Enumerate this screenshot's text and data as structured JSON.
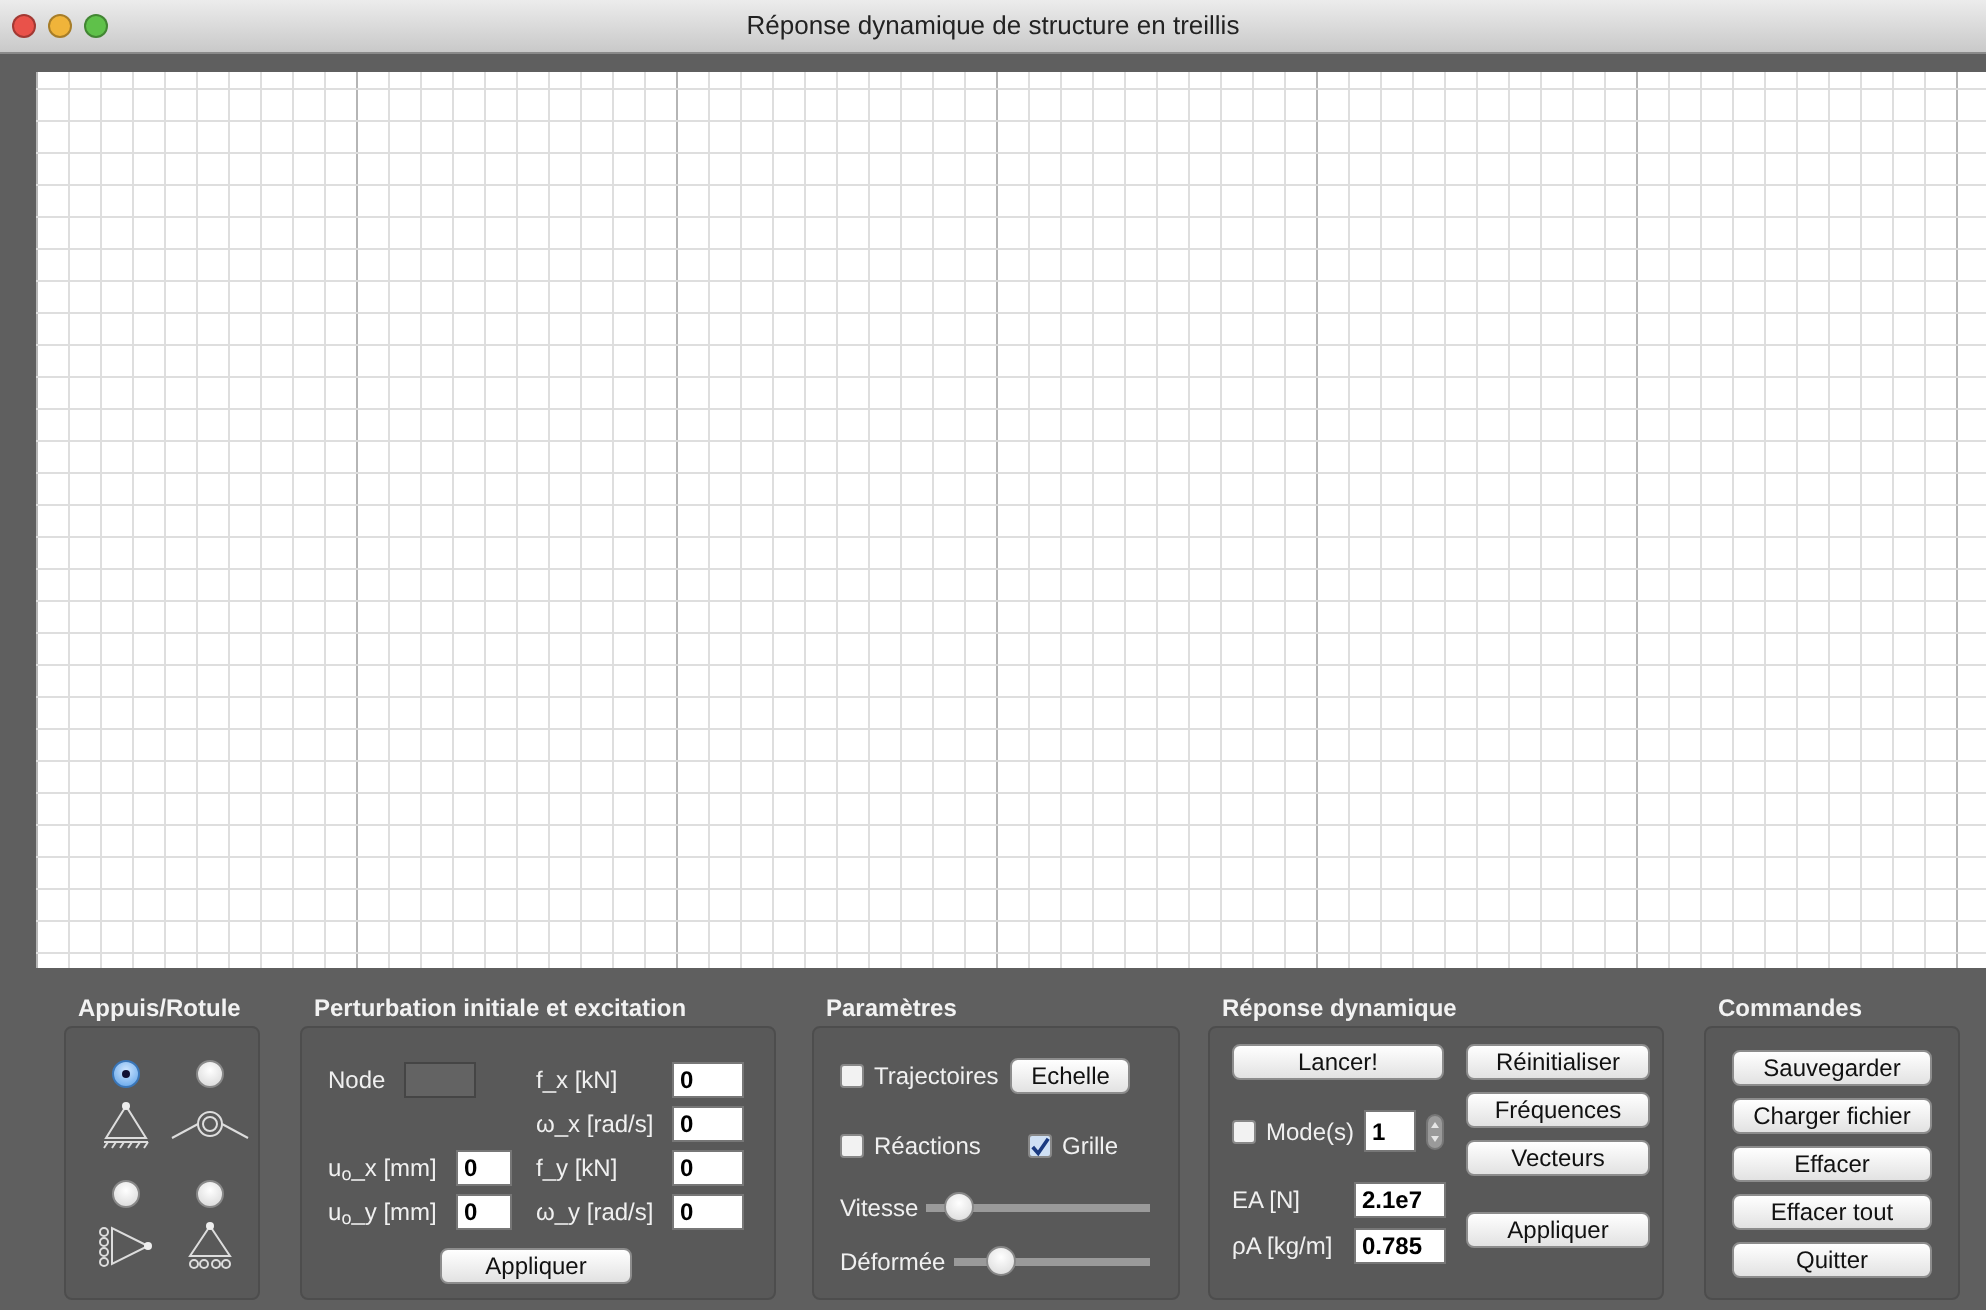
{
  "window": {
    "title": "Réponse dynamique de structure en treillis"
  },
  "supports": {
    "title": "Appuis/Rotule",
    "options": [
      {
        "kind": "pinned",
        "selected": true
      },
      {
        "kind": "hinge",
        "selected": false
      },
      {
        "kind": "roller_side",
        "selected": false
      },
      {
        "kind": "roller",
        "selected": false
      }
    ]
  },
  "perturbation": {
    "title": "Perturbation initiale et excitation",
    "node": {
      "label": "Node",
      "disabled": true
    },
    "left_fields": [
      {
        "label": "u$_{o}$_x [mm]",
        "value": "0"
      },
      {
        "label": "u$_{o}$_y [mm]",
        "value": "0"
      }
    ],
    "right_fields": [
      {
        "label": "f_x [kN]",
        "value": "0"
      },
      {
        "label": "ω_x [rad/s]",
        "value": "0"
      },
      {
        "label": "f_y [kN]",
        "value": "0"
      },
      {
        "label": "ω_y [rad/s]",
        "value": "0"
      }
    ],
    "button": "Appliquer"
  },
  "parameters": {
    "title": "Paramètres",
    "checkboxes": [
      {
        "label": "Trajectoires",
        "checked": false
      },
      {
        "label": "Réactions",
        "checked": false
      },
      {
        "label": "Grille",
        "checked": true
      }
    ],
    "button": "Echelle",
    "sliders": [
      {
        "label": "Vitesse",
        "level": 0.14
      },
      {
        "label": "Déformée",
        "level": 0.24
      }
    ]
  },
  "response": {
    "title": "Réponse dynamique",
    "run_button": "Lancer!",
    "side_buttons": [
      "Réinitialiser",
      "Fréquences",
      "Vecteurs"
    ],
    "mode": {
      "label": "Mode(s)",
      "checked": false,
      "value": "1"
    },
    "fields": [
      {
        "label": "EA [N]",
        "value": "2.1e7"
      },
      {
        "label": "ρA [kg/m]",
        "value": "0.785"
      }
    ],
    "apply_button": "Appliquer"
  },
  "commands": {
    "title": "Commandes",
    "buttons": [
      "Sauvegarder",
      "Charger fichier",
      "Effacer",
      "Effacer tout",
      "Quitter"
    ]
  }
}
